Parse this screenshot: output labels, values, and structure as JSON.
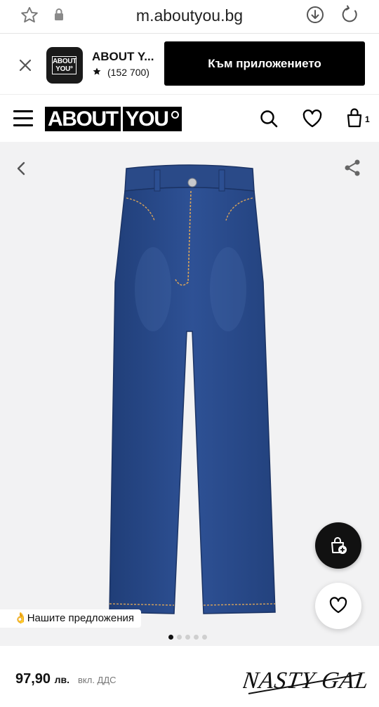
{
  "browser": {
    "url": "m.aboutyou.bg"
  },
  "app_banner": {
    "app_name": "ABOUT Y...",
    "logo_text_line1": "ABOUT",
    "logo_text_line2": "YOU°",
    "rating_count": "(152 700)",
    "cta_label": "Към приложението"
  },
  "header": {
    "logo_part1": "ABOUT",
    "logo_part2": "YOU",
    "cart_count": "1"
  },
  "gallery": {
    "image_count": 5,
    "active_index": 0,
    "suggestions_emoji": "👌",
    "suggestions_label": "Нашите предложения"
  },
  "product": {
    "price": "97,90",
    "currency": "лв.",
    "vat_note": "вкл. ДДС",
    "brand": "NASTY GAL"
  },
  "colors": {
    "primary": "#000000",
    "gallery_bg": "#f2f2f3",
    "denim": "#2b4b88"
  }
}
